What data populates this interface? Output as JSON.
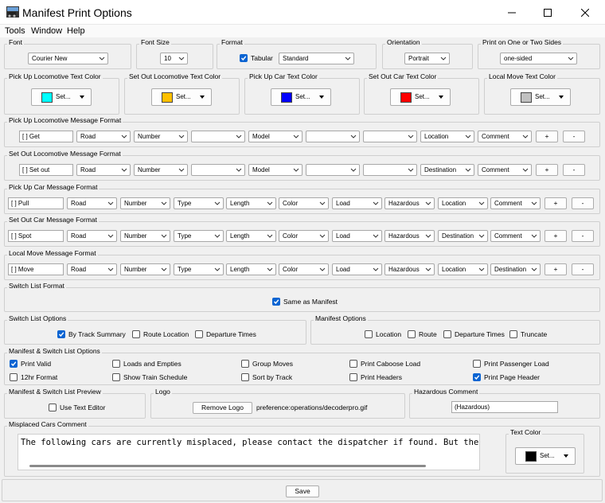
{
  "window": {
    "title": "Manifest Print Options"
  },
  "menu": [
    "Tools",
    "Window",
    "Help"
  ],
  "colors": {
    "pick_up_loco": "#00ffff",
    "set_out_loco": "#ffc000",
    "pick_up_car": "#0000ff",
    "set_out_car": "#ff0000",
    "local_move": "#c0c0c0",
    "misplaced_text": "#000000",
    "check_accent": "#0a64d2"
  },
  "font": {
    "title": "Font",
    "value": "Courier New"
  },
  "font_size": {
    "title": "Font Size",
    "value": "10"
  },
  "format": {
    "title": "Format",
    "tabular_label": "Tabular",
    "tabular_checked": true,
    "value": "Standard"
  },
  "orientation": {
    "title": "Orientation",
    "value": "Portrait"
  },
  "sides": {
    "title": "Print on One or Two Sides",
    "value": "one-sided"
  },
  "text_colors": [
    {
      "title": "Pick Up Locomotive Text Color",
      "button": "Set..."
    },
    {
      "title": "Set Out Locomotive Text Color",
      "button": "Set..."
    },
    {
      "title": "Pick Up Car Text Color",
      "button": "Set..."
    },
    {
      "title": "Set Out Car Text Color",
      "button": "Set..."
    },
    {
      "title": "Local Move Text Color",
      "button": "Set..."
    }
  ],
  "pickup_loco_format": {
    "title": "Pick Up Locomotive Message Format",
    "prefix": "[ ] Get",
    "fields": [
      "Road",
      "Number",
      "",
      "Model",
      "",
      "",
      "Location",
      "Comment"
    ],
    "add": "+",
    "remove": "-"
  },
  "setout_loco_format": {
    "title": "Set Out Locomotive Message Format",
    "prefix": "[ ] Set out",
    "fields": [
      "Road",
      "Number",
      "",
      "Model",
      "",
      "",
      "Destination",
      "Comment"
    ],
    "add": "+",
    "remove": "-"
  },
  "pickup_car_format": {
    "title": "Pick Up Car Message Format",
    "prefix": "[ ] Pull",
    "fields": [
      "Road",
      "Number",
      "Type",
      "Length",
      "Color",
      "Load",
      "Hazardous",
      "Location",
      "Comment"
    ],
    "add": "+",
    "remove": "-"
  },
  "setout_car_format": {
    "title": "Set Out Car Message Format",
    "prefix": "[ ] Spot",
    "fields": [
      "Road",
      "Number",
      "Type",
      "Length",
      "Color",
      "Load",
      "Hazardous",
      "Destination",
      "Comment"
    ],
    "add": "+",
    "remove": "-"
  },
  "local_move_format": {
    "title": "Local Move Message Format",
    "prefix": "[ ] Move",
    "fields": [
      "Road",
      "Number",
      "Type",
      "Length",
      "Color",
      "Load",
      "Hazardous",
      "Location",
      "Destination"
    ],
    "add": "+",
    "remove": "-"
  },
  "switch_list_format": {
    "title": "Switch List Format",
    "same_as_manifest": "Same as Manifest",
    "checked": true
  },
  "switch_list_options": {
    "title": "Switch List Options",
    "items": [
      {
        "label": "By Track Summary",
        "checked": true
      },
      {
        "label": "Route Location",
        "checked": false
      },
      {
        "label": "Departure Times",
        "checked": false
      }
    ]
  },
  "manifest_options": {
    "title": "Manifest Options",
    "items": [
      {
        "label": "Location",
        "checked": false
      },
      {
        "label": "Route",
        "checked": false
      },
      {
        "label": "Departure Times",
        "checked": false
      },
      {
        "label": "Truncate",
        "checked": false
      }
    ]
  },
  "ms_options": {
    "title": "Manifest & Switch List Options",
    "items": [
      {
        "label": "Print Valid",
        "checked": true
      },
      {
        "label": "Loads and Empties",
        "checked": false
      },
      {
        "label": "Group Moves",
        "checked": false
      },
      {
        "label": "Print Caboose Load",
        "checked": false
      },
      {
        "label": "Print Passenger Load",
        "checked": false
      },
      {
        "label": "12hr Format",
        "checked": false
      },
      {
        "label": "Show Train Schedule",
        "checked": false
      },
      {
        "label": "Sort by Track",
        "checked": false
      },
      {
        "label": "Print Headers",
        "checked": false
      },
      {
        "label": "Print Page Header",
        "checked": true
      }
    ]
  },
  "preview": {
    "title": "Manifest & Switch List Preview",
    "use_text_editor": "Use Text Editor",
    "checked": false
  },
  "logo": {
    "title": "Logo",
    "remove_button": "Remove Logo",
    "path": "preference:operations/decoderpro.gif"
  },
  "hazardous": {
    "title": "Hazardous Comment",
    "value": "(Hazardous)"
  },
  "misplaced": {
    "title": "Misplaced Cars Comment",
    "text": "The following cars are currently misplaced, please contact the dispatcher if found. But the",
    "text_color_title": "Text Color",
    "button": "Set..."
  },
  "save_button": "Save"
}
